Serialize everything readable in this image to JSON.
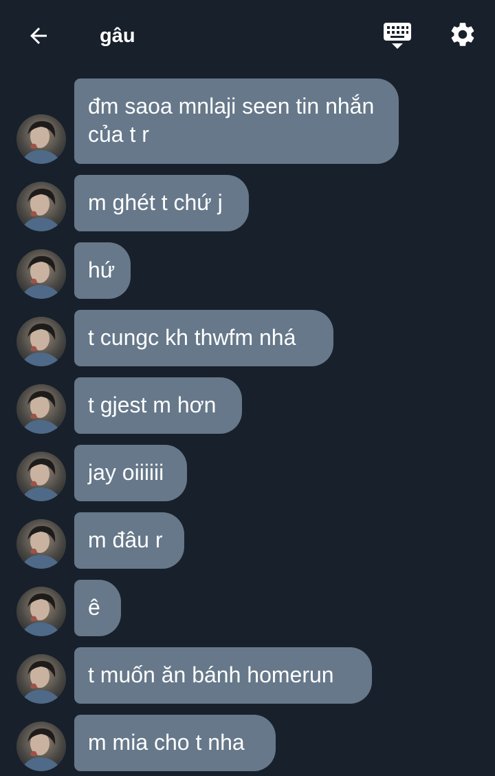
{
  "header": {
    "title": "gâu",
    "back_icon": "arrow-left-icon",
    "keyboard_icon": "keyboard-icon",
    "settings_icon": "gear-icon"
  },
  "colors": {
    "background": "#18202b",
    "bubble": "#66788a",
    "text": "#ffffff"
  },
  "messages": [
    {
      "text": "đm saoa mnlaji seen tin nhắn của t r"
    },
    {
      "text": "m ghét t chứ j"
    },
    {
      "text": "hứ"
    },
    {
      "text": "t cungc kh thwfm nhá"
    },
    {
      "text": "t gjest m hơn"
    },
    {
      "text": "jay oiiiiii"
    },
    {
      "text": "m đâu r"
    },
    {
      "text": "ê"
    },
    {
      "text": "t muốn ăn bánh homerun"
    },
    {
      "text": "m mia cho t nha"
    }
  ]
}
